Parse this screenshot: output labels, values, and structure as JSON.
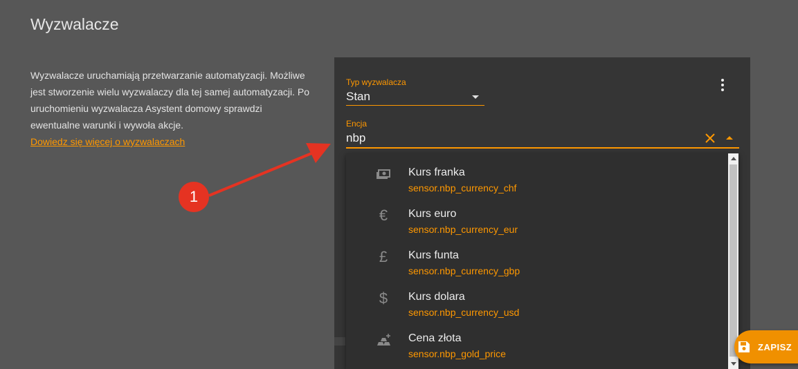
{
  "page": {
    "title": "Wyzwalacze",
    "description": "Wyzwalacze uruchamiają przetwarzanie automatyzacji. Możliwe jest stworzenie wielu wyzwalaczy dla tej samej automatyzacji. Po uruchomieniu wyzwalacza Asystent domowy sprawdzi ewentualne warunki i wywoła akcje.",
    "learn_more_link": "Dowiedz się więcej o wyzwalaczach"
  },
  "trigger": {
    "type_label": "Typ wyzwalacza",
    "type_value": "Stan",
    "entity_label": "Encja",
    "entity_value": "nbp"
  },
  "dropdown": {
    "options": [
      {
        "name": "Kurs franka",
        "entity_id": "sensor.nbp_currency_chf",
        "icon": "cash-icon"
      },
      {
        "name": "Kurs euro",
        "entity_id": "sensor.nbp_currency_eur",
        "icon": "euro-icon"
      },
      {
        "name": "Kurs funta",
        "entity_id": "sensor.nbp_currency_gbp",
        "icon": "pound-icon"
      },
      {
        "name": "Kurs dolara",
        "entity_id": "sensor.nbp_currency_usd",
        "icon": "dollar-icon"
      },
      {
        "name": "Cena złota",
        "entity_id": "sensor.nbp_gold_price",
        "icon": "gold-icon"
      }
    ]
  },
  "save_button": {
    "label": "ZAPISZ"
  },
  "annotation": {
    "badge": "1"
  },
  "colors": {
    "background": "#575757",
    "card": "#353535",
    "accent": "#ff9800",
    "annotation": "#e53322"
  }
}
